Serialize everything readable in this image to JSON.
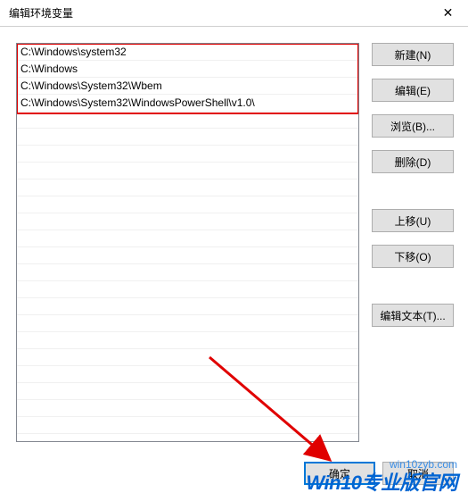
{
  "window": {
    "title": "编辑环境变量",
    "close_icon": "✕"
  },
  "paths": [
    "C:\\Windows\\system32",
    "C:\\Windows",
    "C:\\Windows\\System32\\Wbem",
    "C:\\Windows\\System32\\WindowsPowerShell\\v1.0\\"
  ],
  "buttons": {
    "new": "新建(N)",
    "edit": "编辑(E)",
    "browse": "浏览(B)...",
    "delete": "删除(D)",
    "move_up": "上移(U)",
    "move_down": "下移(O)",
    "edit_text": "编辑文本(T)...",
    "ok": "确定",
    "cancel": "取消"
  },
  "watermark": {
    "small": "win10zyb.com",
    "big": "Win10专业版官网"
  }
}
